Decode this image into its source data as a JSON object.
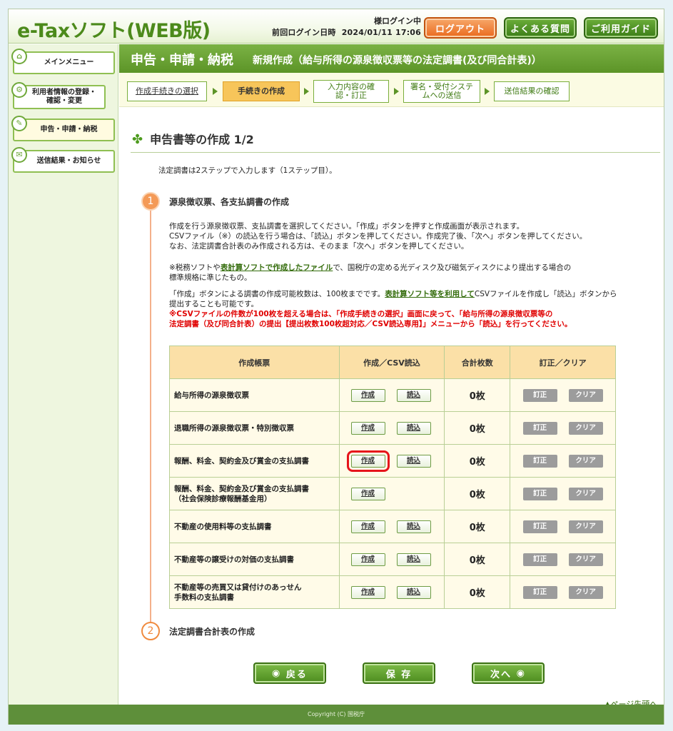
{
  "header": {
    "logo": "e-Taxソフト(WEB版)",
    "login_status": "様ログイン中",
    "last_login_label": "前回ログイン日時",
    "last_login_value": "2024/01/11 17:06",
    "logout_label": "ログアウト",
    "faq_label": "よくある質問",
    "guide_label": "ご利用ガイド"
  },
  "sidebar": {
    "items": [
      {
        "label": "メインメニュー"
      },
      {
        "label": "利用者情報の登録・確認・変更"
      },
      {
        "label": "申告・申請・納税"
      },
      {
        "label": "送信結果・お知らせ"
      }
    ]
  },
  "title": {
    "main": "申告・申請・納税",
    "sub": "新規作成（給与所得の源泉徴収票等の法定調書(及び同合計表)）"
  },
  "steps": [
    {
      "label": "作成手続きの選択"
    },
    {
      "label": "手続きの作成"
    },
    {
      "label": "入力内容の確認・訂正"
    },
    {
      "label": "署名・受付システムへの送信"
    },
    {
      "label": "送信結果の確認"
    }
  ],
  "page_title": "申告書等の作成 1/2",
  "intro": "法定調書は2ステップで入力します（1ステップ目）。",
  "step1": {
    "num": "1",
    "heading": "源泉徴収票、各支払調書の作成",
    "p1": "作成を行う源泉徴収票、支払調書を選択してください。「作成」ボタンを押すと作成画面が表示されます。",
    "p2": "CSVファイル（※）の読込を行う場合は、「読込」ボタンを押してください。作成完了後、「次へ」ボタンを押してください。",
    "p3": "なお、法定調書合計表のみ作成される方は、そのまま「次へ」ボタンを押してください。",
    "note_prefix": "※税務ソフトや",
    "note_link": "表計算ソフトで作成したファイル",
    "note_suffix": "で、国税庁の定める光ディスク及び磁気ディスクにより提出する場合の",
    "note_line2": "標準規格に準じたもの。",
    "limit_prefix": "「作成」ボタンによる調書の作成可能枚数は、100枚までです。",
    "limit_link": "表計算ソフト等を利用して",
    "limit_suffix": "CSVファイルを作成し「読込」ボタンから",
    "limit_line2": "提出することも可能です。",
    "warn_line1": "※CSVファイルの件数が100枚を超える場合は、「作成手続きの選択」画面に戻って、「給与所得の源泉徴収票等の",
    "warn_line2": "法定調書（及び同合計表）の提出【提出枚数100枚超対応／CSV読込専用】」メニューから「読込」を行ってください。"
  },
  "table": {
    "headers": [
      "作成帳票",
      "作成／CSV読込",
      "合計枚数",
      "訂正／クリア"
    ],
    "create_label": "作成",
    "read_label": "読込",
    "fix_label": "訂正",
    "clear_label": "クリア",
    "rows": [
      {
        "name": "給与所得の源泉徴収票",
        "count": "0枚"
      },
      {
        "name": "退職所得の源泉徴収票・特別徴収票",
        "count": "0枚"
      },
      {
        "name": "報酬、料金、契約金及び賞金の支払調書",
        "count": "0枚"
      },
      {
        "name1": "報酬、料金、契約金及び賞金の支払調書",
        "name2": "（社会保険診療報酬基金用）",
        "count": "0枚"
      },
      {
        "name": "不動産の使用料等の支払調書",
        "count": "0枚"
      },
      {
        "name": "不動産等の譲受けの対価の支払調書",
        "count": "0枚"
      },
      {
        "name1": "不動産等の売買又は貸付けのあっせん",
        "name2": "手数料の支払調書",
        "count": "0枚"
      }
    ]
  },
  "step2": {
    "num": "2",
    "heading": "法定調書合計表の作成"
  },
  "buttons": {
    "back": "戻る",
    "save": "保 存",
    "next": "次へ"
  },
  "pagetop_label": "ページ先頭へ",
  "footer": "Copyright (C) 国税庁"
}
